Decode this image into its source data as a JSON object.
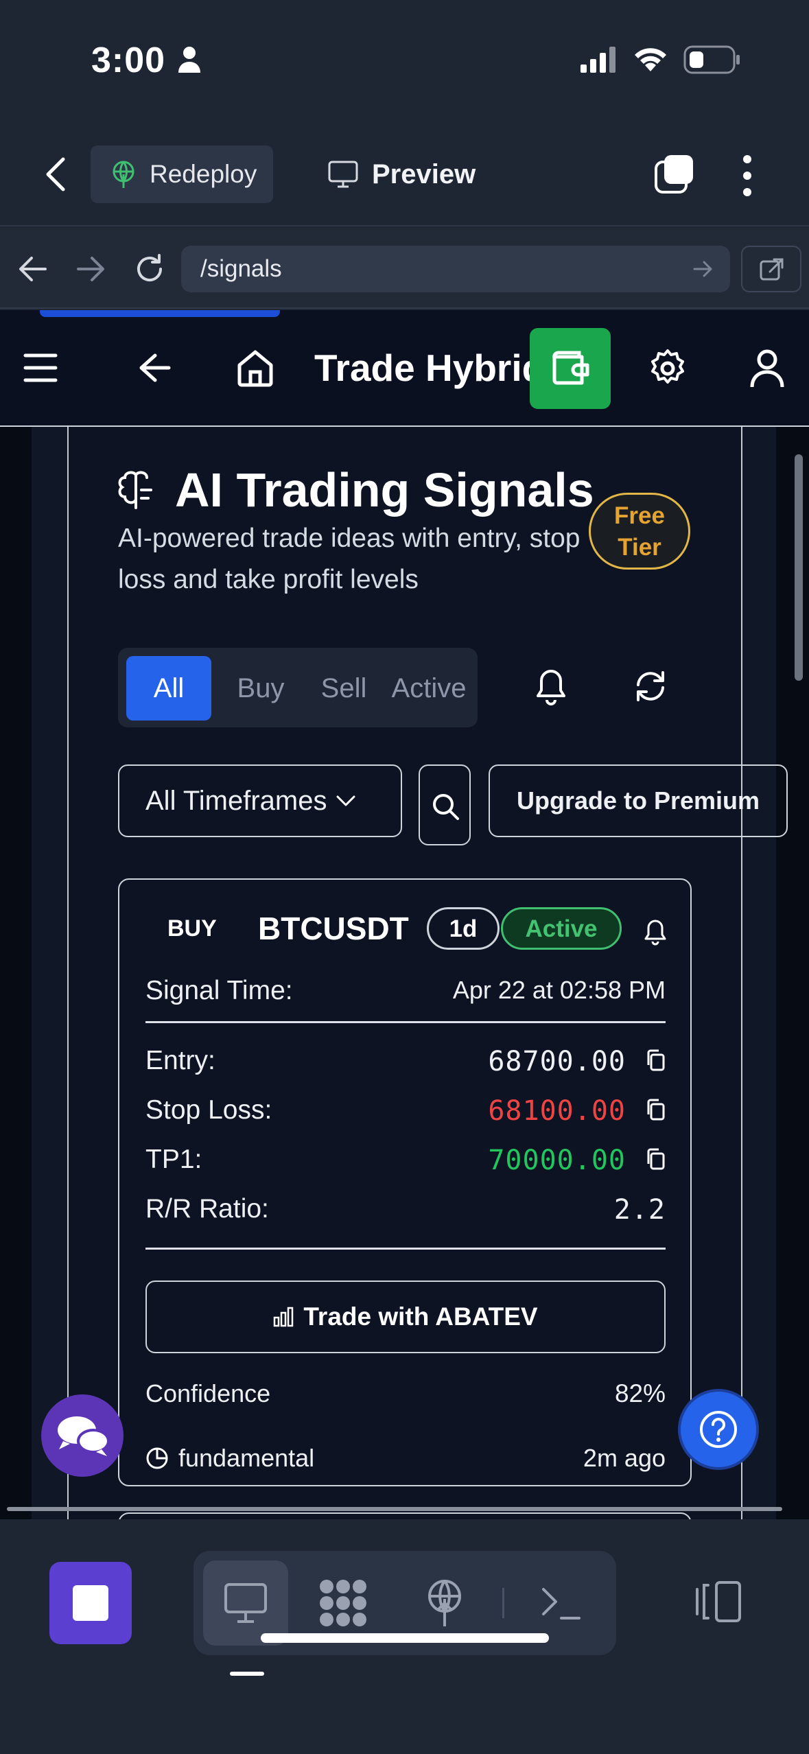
{
  "status_bar": {
    "time": "3:00"
  },
  "replit_header": {
    "redeploy_label": "Redeploy",
    "preview_label": "Preview"
  },
  "url_bar": {
    "url": "/signals"
  },
  "app_nav": {
    "brand": "Trade Hybrid"
  },
  "page": {
    "title": "AI Trading Signals",
    "subtitle": "AI-powered trade ideas with entry, stop loss and take profit levels",
    "tier_badge_line1": "Free",
    "tier_badge_line2": "Tier"
  },
  "filters": {
    "tabs": [
      "All",
      "Buy",
      "Sell",
      "Active"
    ],
    "active_tab": "All",
    "timeframe": "All Timeframes",
    "upgrade_label": "Upgrade to Premium"
  },
  "signal": {
    "direction": "BUY",
    "symbol": "BTCUSDT",
    "timeframe": "1d",
    "status": "Active",
    "signal_time_label": "Signal Time:",
    "signal_time": "Apr 22 at 02:58 PM",
    "entry_label": "Entry:",
    "entry": "68700.00",
    "stop_loss_label": "Stop Loss:",
    "stop_loss": "68100.00",
    "tp1_label": "TP1:",
    "tp1": "70000.00",
    "rr_label": "R/R Ratio:",
    "rr": "2.2",
    "trade_button": "Trade with ABATEV",
    "confidence_label": "Confidence",
    "confidence": "82%",
    "source": "fundamental",
    "age": "2m ago"
  },
  "colors": {
    "accent_blue": "#2563eb",
    "wallet_green": "#1aa64c",
    "stop_loss_red": "#ef4444",
    "take_profit_green": "#22c55e",
    "free_tier_gold": "#e5a432",
    "stop_purple": "#5b3fd1"
  }
}
